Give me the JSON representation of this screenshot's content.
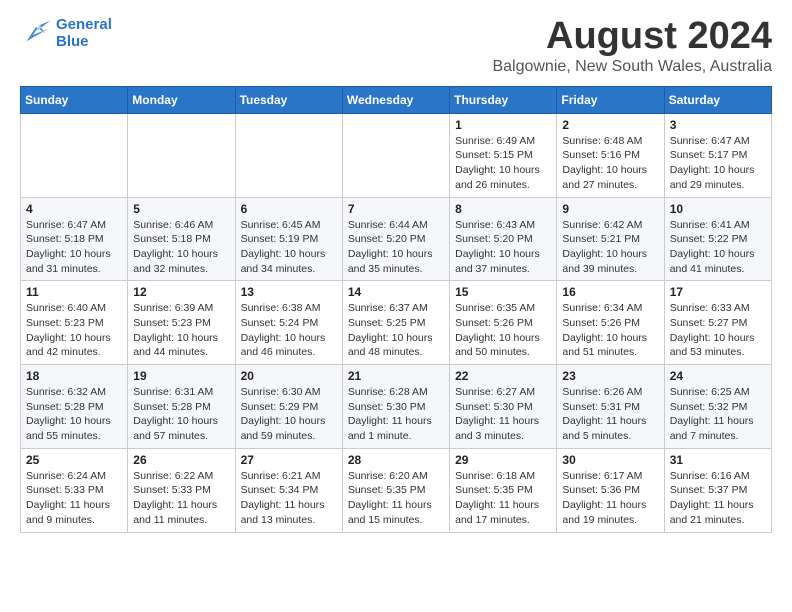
{
  "header": {
    "logo_line1": "General",
    "logo_line2": "Blue",
    "month_year": "August 2024",
    "location": "Balgownie, New South Wales, Australia"
  },
  "days_of_week": [
    "Sunday",
    "Monday",
    "Tuesday",
    "Wednesday",
    "Thursday",
    "Friday",
    "Saturday"
  ],
  "weeks": [
    [
      {
        "day": "",
        "info": ""
      },
      {
        "day": "",
        "info": ""
      },
      {
        "day": "",
        "info": ""
      },
      {
        "day": "",
        "info": ""
      },
      {
        "day": "1",
        "info": "Sunrise: 6:49 AM\nSunset: 5:15 PM\nDaylight: 10 hours\nand 26 minutes."
      },
      {
        "day": "2",
        "info": "Sunrise: 6:48 AM\nSunset: 5:16 PM\nDaylight: 10 hours\nand 27 minutes."
      },
      {
        "day": "3",
        "info": "Sunrise: 6:47 AM\nSunset: 5:17 PM\nDaylight: 10 hours\nand 29 minutes."
      }
    ],
    [
      {
        "day": "4",
        "info": "Sunrise: 6:47 AM\nSunset: 5:18 PM\nDaylight: 10 hours\nand 31 minutes."
      },
      {
        "day": "5",
        "info": "Sunrise: 6:46 AM\nSunset: 5:18 PM\nDaylight: 10 hours\nand 32 minutes."
      },
      {
        "day": "6",
        "info": "Sunrise: 6:45 AM\nSunset: 5:19 PM\nDaylight: 10 hours\nand 34 minutes."
      },
      {
        "day": "7",
        "info": "Sunrise: 6:44 AM\nSunset: 5:20 PM\nDaylight: 10 hours\nand 35 minutes."
      },
      {
        "day": "8",
        "info": "Sunrise: 6:43 AM\nSunset: 5:20 PM\nDaylight: 10 hours\nand 37 minutes."
      },
      {
        "day": "9",
        "info": "Sunrise: 6:42 AM\nSunset: 5:21 PM\nDaylight: 10 hours\nand 39 minutes."
      },
      {
        "day": "10",
        "info": "Sunrise: 6:41 AM\nSunset: 5:22 PM\nDaylight: 10 hours\nand 41 minutes."
      }
    ],
    [
      {
        "day": "11",
        "info": "Sunrise: 6:40 AM\nSunset: 5:23 PM\nDaylight: 10 hours\nand 42 minutes."
      },
      {
        "day": "12",
        "info": "Sunrise: 6:39 AM\nSunset: 5:23 PM\nDaylight: 10 hours\nand 44 minutes."
      },
      {
        "day": "13",
        "info": "Sunrise: 6:38 AM\nSunset: 5:24 PM\nDaylight: 10 hours\nand 46 minutes."
      },
      {
        "day": "14",
        "info": "Sunrise: 6:37 AM\nSunset: 5:25 PM\nDaylight: 10 hours\nand 48 minutes."
      },
      {
        "day": "15",
        "info": "Sunrise: 6:35 AM\nSunset: 5:26 PM\nDaylight: 10 hours\nand 50 minutes."
      },
      {
        "day": "16",
        "info": "Sunrise: 6:34 AM\nSunset: 5:26 PM\nDaylight: 10 hours\nand 51 minutes."
      },
      {
        "day": "17",
        "info": "Sunrise: 6:33 AM\nSunset: 5:27 PM\nDaylight: 10 hours\nand 53 minutes."
      }
    ],
    [
      {
        "day": "18",
        "info": "Sunrise: 6:32 AM\nSunset: 5:28 PM\nDaylight: 10 hours\nand 55 minutes."
      },
      {
        "day": "19",
        "info": "Sunrise: 6:31 AM\nSunset: 5:28 PM\nDaylight: 10 hours\nand 57 minutes."
      },
      {
        "day": "20",
        "info": "Sunrise: 6:30 AM\nSunset: 5:29 PM\nDaylight: 10 hours\nand 59 minutes."
      },
      {
        "day": "21",
        "info": "Sunrise: 6:28 AM\nSunset: 5:30 PM\nDaylight: 11 hours\nand 1 minute."
      },
      {
        "day": "22",
        "info": "Sunrise: 6:27 AM\nSunset: 5:30 PM\nDaylight: 11 hours\nand 3 minutes."
      },
      {
        "day": "23",
        "info": "Sunrise: 6:26 AM\nSunset: 5:31 PM\nDaylight: 11 hours\nand 5 minutes."
      },
      {
        "day": "24",
        "info": "Sunrise: 6:25 AM\nSunset: 5:32 PM\nDaylight: 11 hours\nand 7 minutes."
      }
    ],
    [
      {
        "day": "25",
        "info": "Sunrise: 6:24 AM\nSunset: 5:33 PM\nDaylight: 11 hours\nand 9 minutes."
      },
      {
        "day": "26",
        "info": "Sunrise: 6:22 AM\nSunset: 5:33 PM\nDaylight: 11 hours\nand 11 minutes."
      },
      {
        "day": "27",
        "info": "Sunrise: 6:21 AM\nSunset: 5:34 PM\nDaylight: 11 hours\nand 13 minutes."
      },
      {
        "day": "28",
        "info": "Sunrise: 6:20 AM\nSunset: 5:35 PM\nDaylight: 11 hours\nand 15 minutes."
      },
      {
        "day": "29",
        "info": "Sunrise: 6:18 AM\nSunset: 5:35 PM\nDaylight: 11 hours\nand 17 minutes."
      },
      {
        "day": "30",
        "info": "Sunrise: 6:17 AM\nSunset: 5:36 PM\nDaylight: 11 hours\nand 19 minutes."
      },
      {
        "day": "31",
        "info": "Sunrise: 6:16 AM\nSunset: 5:37 PM\nDaylight: 11 hours\nand 21 minutes."
      }
    ]
  ]
}
